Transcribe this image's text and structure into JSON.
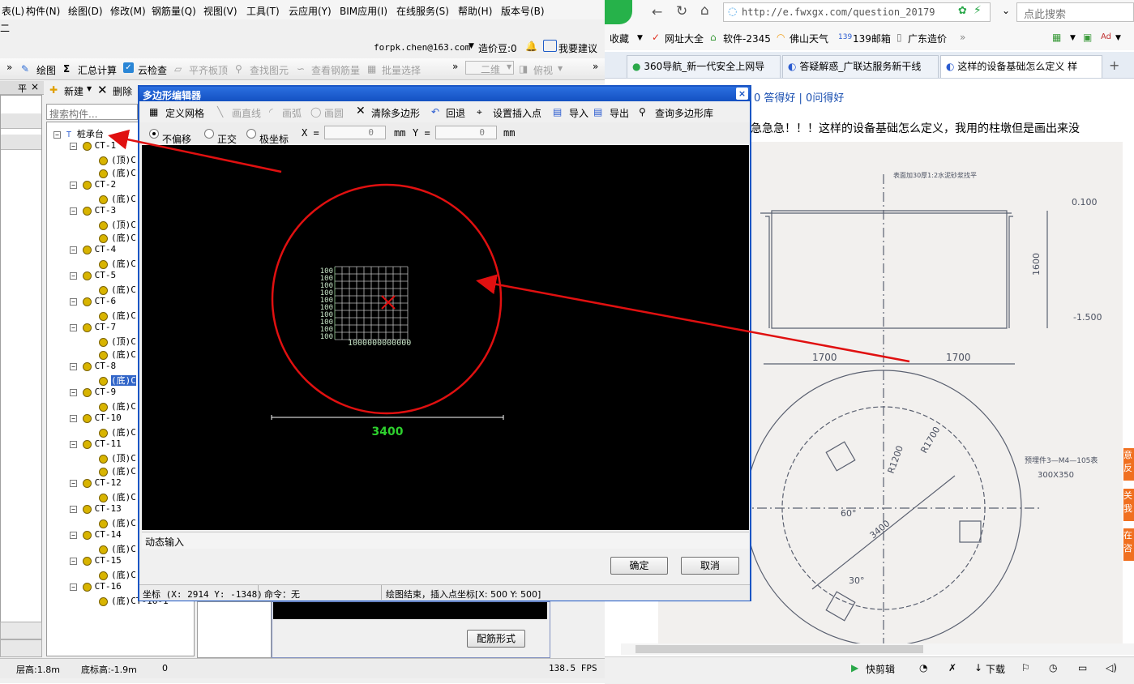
{
  "left_app": {
    "menu": [
      "表(L)",
      "构件(N)",
      "绘图(D)",
      "修改(M)",
      "钢筋量(Q)",
      "视图(V)",
      "工具(T)",
      "云应用(Y)",
      "BIM应用(I)",
      "在线服务(S)",
      "帮助(H)",
      "版本号(B)"
    ],
    "sub_label": "二",
    "account": "forpk.chen@163.com",
    "cost_bean": "造价豆:0",
    "suggest": "我要建议",
    "toolbar": {
      "draw": "绘图",
      "sum_calc": "汇总计算",
      "cloud_check": "云检查",
      "flat_top": "平齐板顶",
      "find_elem": "查找图元",
      "view_rebar": "查看钢筋量",
      "batch_select": "批量选择",
      "view_2d": "二维",
      "view_top": "俯视"
    },
    "panel": {
      "pin": "平",
      "close": "×",
      "new": "新建",
      "delete": "删除",
      "search_placeholder": "搜索构件..."
    },
    "tree": {
      "root": "桩承台",
      "nodes": [
        {
          "name": "CT-1",
          "children": [
            "(顶)C",
            "(底)C"
          ]
        },
        {
          "name": "CT-2",
          "children": [
            "(底)C"
          ]
        },
        {
          "name": "CT-3",
          "children": [
            "(顶)C",
            "(底)C"
          ]
        },
        {
          "name": "CT-4",
          "children": [
            "(底)C"
          ]
        },
        {
          "name": "CT-5",
          "children": [
            "(底)C"
          ]
        },
        {
          "name": "CT-6",
          "children": [
            "(底)C"
          ]
        },
        {
          "name": "CT-7",
          "children": [
            "(顶)C",
            "(底)C"
          ]
        },
        {
          "name": "CT-8",
          "children": [
            "(底)C"
          ]
        },
        {
          "name": "CT-9",
          "children": [
            "(底)C"
          ]
        },
        {
          "name": "CT-10",
          "children": [
            "(底)C"
          ]
        },
        {
          "name": "CT-11",
          "children": [
            "(顶)C",
            "(底)C"
          ]
        },
        {
          "name": "CT-12",
          "children": [
            "(底)C"
          ]
        },
        {
          "name": "CT-13",
          "children": [
            "(底)C"
          ]
        },
        {
          "name": "CT-14",
          "children": [
            "(底)C"
          ]
        },
        {
          "name": "CT-15",
          "children": [
            "(底)C"
          ]
        },
        {
          "name": "CT-16",
          "children": [
            "(底)CT-16-1"
          ]
        }
      ]
    },
    "rebar_form_button": "配筋形式",
    "status": {
      "floor_height": "层高:1.8m",
      "bottom_elev": "底标高:-1.9m",
      "zero": "0",
      "fps": "138.5 FPS"
    }
  },
  "dialog": {
    "title": "多边形编辑器",
    "close": "×",
    "toolbar": {
      "define_grid": "定义网格",
      "draw_line": "画直线",
      "draw_arc": "画弧",
      "draw_circle": "画圆",
      "clear_polygon": "清除多边形",
      "undo": "回退",
      "set_insert": "设置插入点",
      "import": "导入",
      "export": "导出",
      "query_lib": "查询多边形库"
    },
    "options": {
      "no_offset": "不偏移",
      "ortho": "正交",
      "polar": "极坐标",
      "x_label": "X =",
      "x_val": "0",
      "y_label": "Y =",
      "y_val": "0",
      "unit": "mm"
    },
    "canvas": {
      "grid_label": "100",
      "grid_bottom_label": "1000000000000",
      "dimension": "3400"
    },
    "dynamic_input": "动态输入",
    "ok": "确定",
    "cancel": "取消",
    "status": {
      "coords": "坐标 (X: 2914 Y: -1348)",
      "command": "命令：无",
      "message": "绘图结束，插入点坐标[X: 500 Y: 500]"
    }
  },
  "browser": {
    "url": "http://e.fwxgx.com/question_20179",
    "search_placeholder": "点此搜索",
    "bookmarks": [
      "收藏",
      "网址大全",
      "软件-2345",
      "佛山天气",
      "139邮箱",
      "广东造价"
    ],
    "tabs": [
      "360导航_新一代安全上网导",
      "答疑解惑_广联达服务新干线",
      "这样的设备基础怎么定义 样"
    ],
    "answers": "0 答得好 | 0问得好",
    "question": "急急急！！！这样的设备基础怎么定义，我用的柱墩但是画出来没",
    "drawing_labels": {
      "note": "表面加30厚1:2水泥砂浆找平",
      "elev_top": "0.100",
      "elev_bottom": "-1.500",
      "height": "1600",
      "half_width_left": "1700",
      "half_width_right": "1700",
      "r1200": "R1200",
      "r1700": "R1700",
      "diameter": "3400",
      "angle60": "60°",
      "angle30": "30°",
      "embed_note": "预埋件3—M4—105表",
      "embed_size": "300X350"
    },
    "side_tabs": [
      "意反",
      "关我",
      "在咨"
    ],
    "status": {
      "quick_clip": "快剪辑",
      "download": "下载"
    }
  },
  "colors": {
    "dialog_title": "#1451c2",
    "annotation_red": "#e01010",
    "grid_green": "#9ad89a",
    "dim_green": "#2ed12e"
  }
}
